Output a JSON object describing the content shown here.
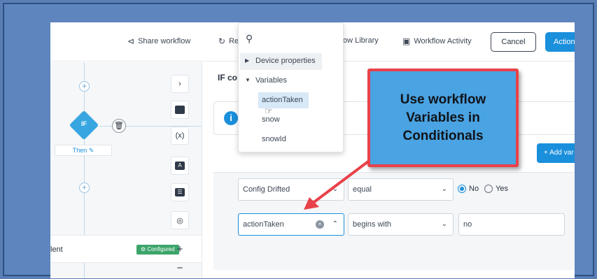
{
  "header": {
    "share_label": "Share workflow",
    "r_label": "Re",
    "library_label": "ow Library",
    "activity_label": "Workflow Activity",
    "cancel_label": "Cancel",
    "action_label": "Action"
  },
  "canvas": {
    "if_label": "IF",
    "then_label": "Then",
    "node_title": "lent",
    "node_badge": "Configured"
  },
  "toolbar": {
    "variables_label": "(x)",
    "text_label": "A",
    "zoom_in": "+",
    "zoom_out": "−"
  },
  "panel": {
    "title": "IF co",
    "add_variable_label": "+ Add var"
  },
  "condition1": {
    "field": "Config Drifted",
    "operator": "equal",
    "option_no": "No",
    "option_yes": "Yes",
    "selected": "No"
  },
  "condition2": {
    "field": "actionTaken",
    "operator": "begins with",
    "value": "no"
  },
  "dropdown": {
    "group1": "Device properties",
    "group2": "Variables",
    "items": [
      "actionTaken",
      "snow",
      "snowId"
    ],
    "selected": "actionTaken"
  },
  "callout": {
    "text": "Use workflow Variables in Conditionals",
    "fill_color": "#4aa3e2",
    "border_color": "#e8424a"
  }
}
